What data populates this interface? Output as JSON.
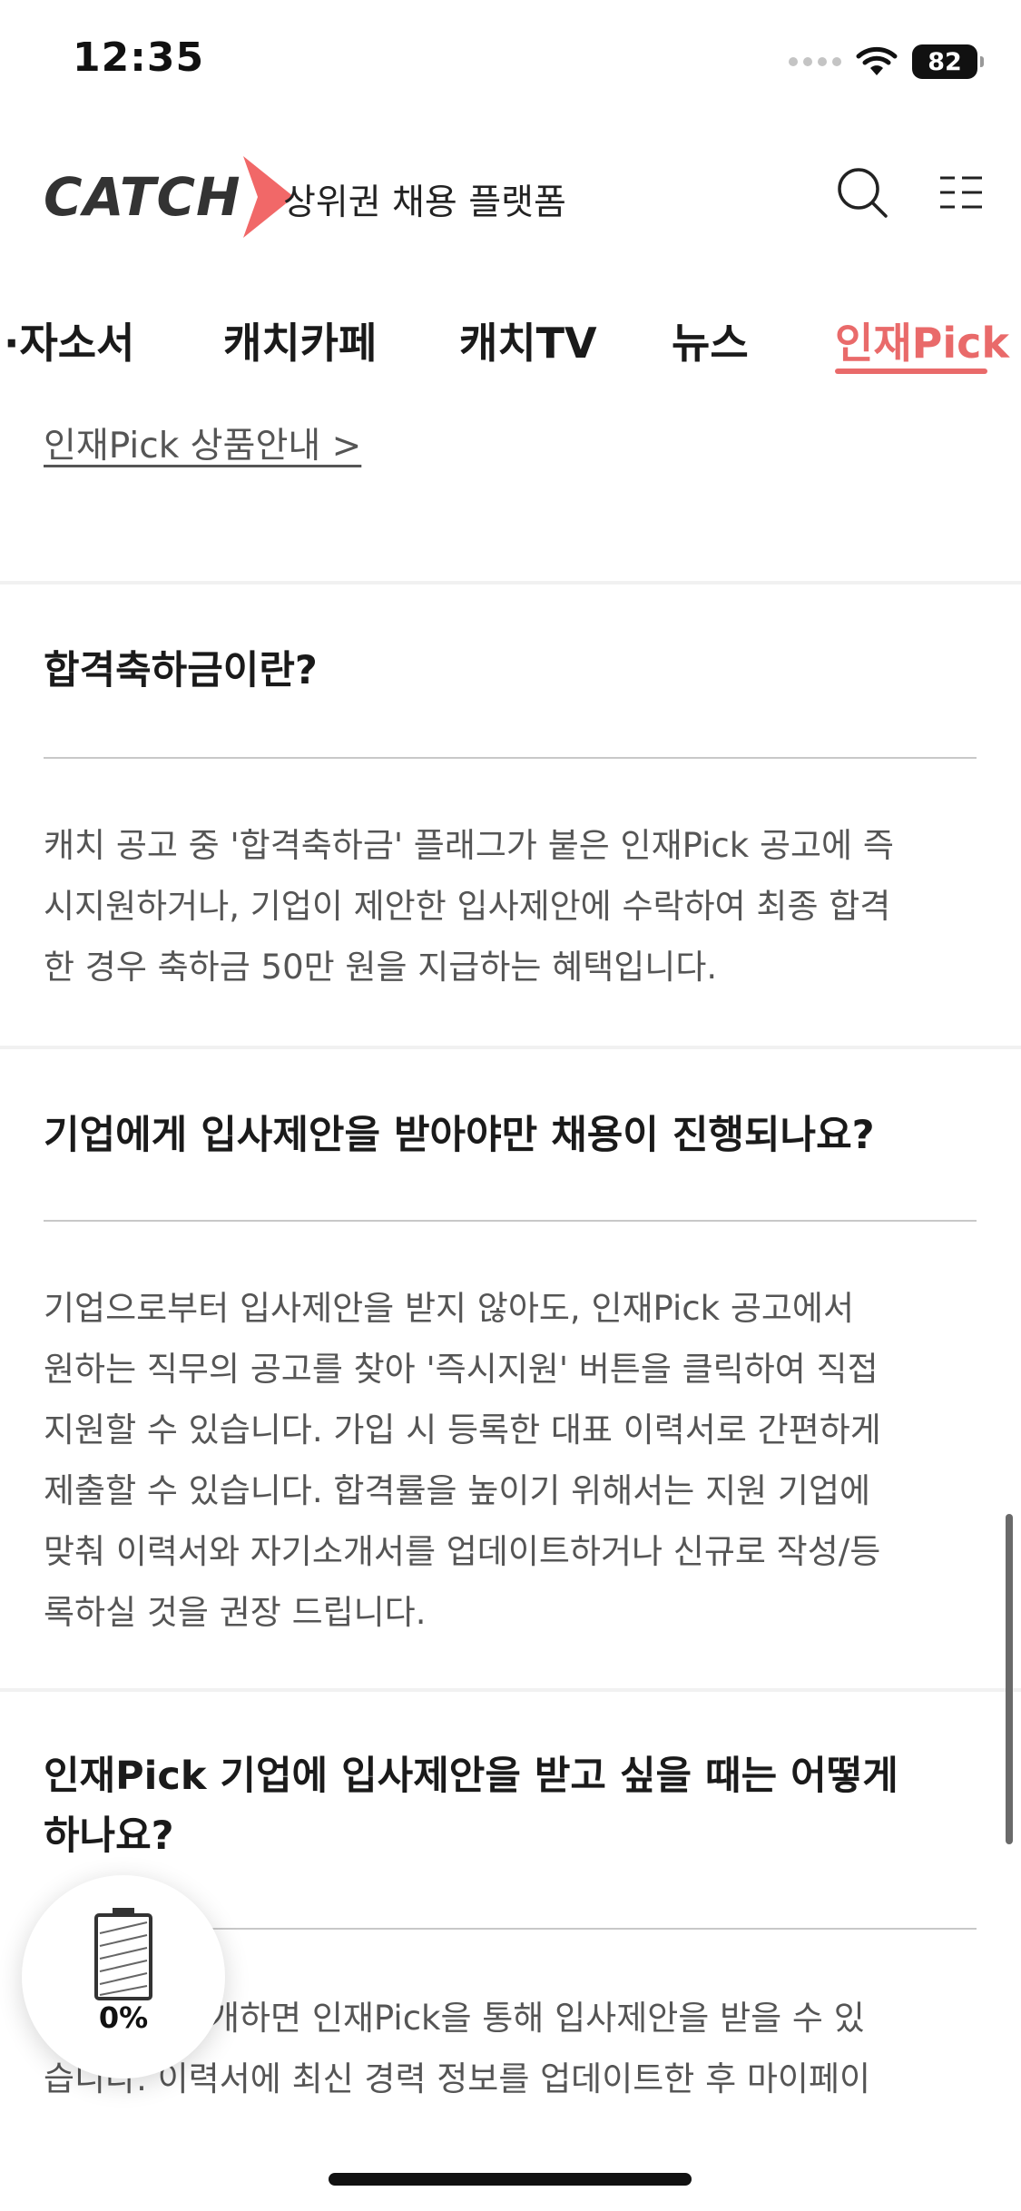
{
  "status_bar": {
    "time": "12:35",
    "battery": "82"
  },
  "header": {
    "logo": "CATCH",
    "tagline": "상위권 채용 플랫폼"
  },
  "tabs": [
    {
      "label": "·자소서"
    },
    {
      "label": "캐치카페"
    },
    {
      "label": "캐치TV"
    },
    {
      "label": "뉴스"
    },
    {
      "label": "인재Pick",
      "active": true
    }
  ],
  "guide_link": "인재Pick 상품안내 >",
  "faq": [
    {
      "question": "합격축하금이란?",
      "answer_lines": [
        "캐치 공고 중 '합격축하금' 플래그가 붙은 인재Pick 공고에 즉",
        "시지원하거나, 기업이 제안한 입사제안에 수락하여 최종 합격",
        "한 경우 축하금 50만 원을 지급하는 혜택입니다."
      ]
    },
    {
      "question": "기업에게 입사제안을 받아야만 채용이 진행되나요?",
      "answer_lines": [
        "기업으로부터 입사제안을 받지 않아도, 인재Pick 공고에서",
        "원하는 직무의 공고를 찾아 '즉시지원' 버튼을 클릭하여 직접",
        "지원할 수 있습니다. 가입 시 등록한 대표 이력서로 간편하게",
        "제출할 수 있습니다. 합격률을 높이기 위해서는 지원 기업에",
        "맞춰 이력서와 자기소개서를 업데이트하거나 신규로 작성/등",
        "록하실 것을 권장 드립니다."
      ]
    },
    {
      "question_lines": [
        "인재Pick 기업에 입사제안을 받고 싶을 때는 어떻게",
        "하나요?"
      ],
      "answer_lines": [
        "이력서를 공개하면 인재Pick을 통해 입사제안을 받을 수 있",
        "습니다. 이력서에 최신 경력 정보를 업데이트한 후 마이페이"
      ]
    }
  ],
  "battery_widget": {
    "percent": "0%"
  },
  "colors": {
    "accent": "#e96a6a",
    "text": "#1a1a1a",
    "body_text": "#555555"
  }
}
